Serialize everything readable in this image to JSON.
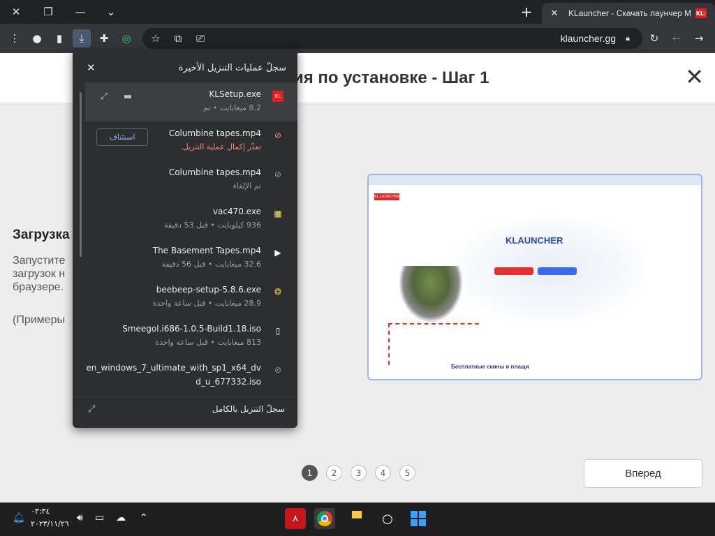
{
  "browser": {
    "tab_title": "KLauncher - Скачать лаунчер M",
    "tab_favicon": "KL:",
    "url": "klauncher.gg"
  },
  "page": {
    "title": "ия по установке - Шаг 1",
    "step_heading": "Загрузка",
    "step_text": "Запустите загрузок н браузере.",
    "step_note": "(Примеры",
    "preview": {
      "logo": "KL LAUNCHER",
      "brand": "KLAUNCHER",
      "footer": "Бесплатные скины и плащи"
    },
    "pagination": [
      "1",
      "2",
      "3",
      "4",
      "5"
    ],
    "active_page": "1",
    "next_label": "Вперед"
  },
  "downloads": {
    "title": "سجلّ عمليات التنزيل الأخيرة",
    "items": [
      {
        "name": "KLSetup.exe",
        "status": "8.2 ميغابايت • تم",
        "icon": "klauncher-app-icon"
      },
      {
        "name": "Columbine tapes.mp4",
        "status": "تعذّر إكمال عملية التنزيل.",
        "icon": "download-failed-icon",
        "action": "استئناف",
        "error": true
      },
      {
        "name": "Columbine tapes.mp4",
        "status": "تم الإلغاء",
        "icon": "download-cancelled-icon"
      },
      {
        "name": "vac470.exe",
        "status": "936 كيلوبايت • قبل 53 دقيقة",
        "icon": "exe-file-icon"
      },
      {
        "name": "The Basement Tapes.mp4",
        "status": "32.6 ميغابايت • قبل 56 دقيقة",
        "icon": "video-file-icon"
      },
      {
        "name": "beebeep-setup-5.8.6.exe",
        "status": "28.9 ميغابايت • قبل ساعة واحدة",
        "icon": "beebeep-app-icon"
      },
      {
        "name": "Smeegol.i686-1.0.5-Build1.18.iso",
        "status": "813 ميغابايت • قبل ساعة واحدة",
        "icon": "file-icon"
      },
      {
        "name": "en_windows_7_ultimate_with_sp1_x64_dv",
        "name2": "d_u_677332.iso",
        "icon": "download-cancelled-icon"
      }
    ],
    "footer": "سجلّ التنزيل بالكامل"
  },
  "taskbar": {
    "time": "٠٣:٣٤",
    "date": "٢٠٢٣/١١/٢٦"
  },
  "colors": {
    "accent_red": "#e02020",
    "link_blue": "#8ab4f8",
    "error_red": "#f28b82"
  }
}
